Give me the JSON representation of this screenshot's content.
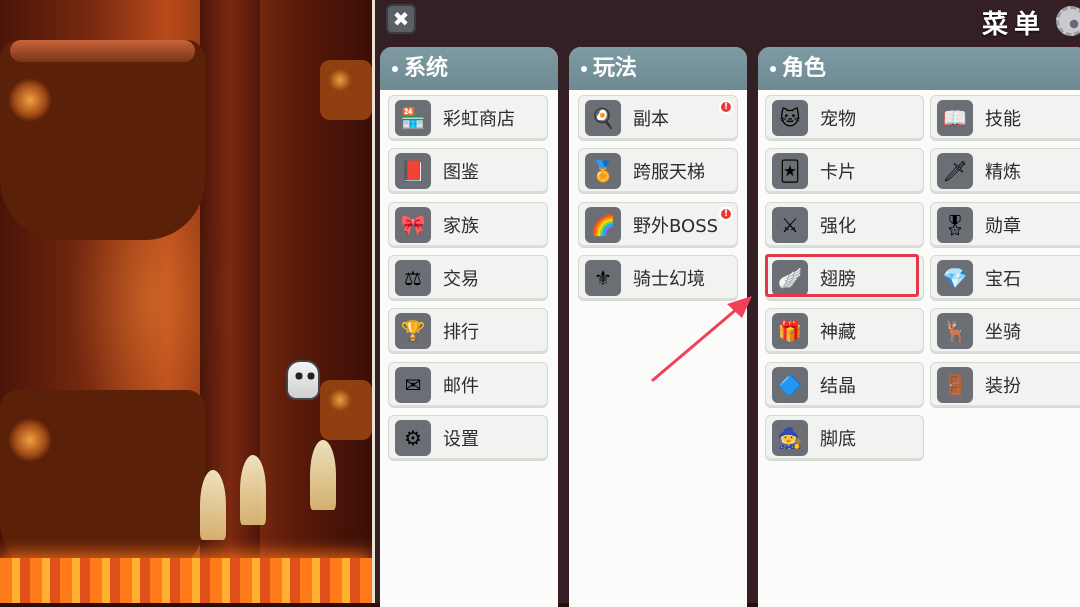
{
  "menu": {
    "title": "菜单",
    "close_symbol": "✖"
  },
  "panels": {
    "system": {
      "header": "系统",
      "items": [
        {
          "label": "彩虹商店",
          "icon": "rainbow-shop-icon",
          "glyph": "🏪"
        },
        {
          "label": "图鉴",
          "icon": "book-icon",
          "glyph": "📕"
        },
        {
          "label": "家族",
          "icon": "family-icon",
          "glyph": "🎀"
        },
        {
          "label": "交易",
          "icon": "trade-icon",
          "glyph": "⚖"
        },
        {
          "label": "排行",
          "icon": "trophy-icon",
          "glyph": "🏆"
        },
        {
          "label": "邮件",
          "icon": "mail-icon",
          "glyph": "✉"
        },
        {
          "label": "设置",
          "icon": "settings-gear-icon",
          "glyph": "⚙"
        }
      ]
    },
    "gameplay": {
      "header": "玩法",
      "items": [
        {
          "label": "副本",
          "icon": "dungeon-icon",
          "glyph": "🍳",
          "badge": "!"
        },
        {
          "label": "跨服天梯",
          "icon": "ladder-icon",
          "glyph": "🏅"
        },
        {
          "label": "野外BOSS",
          "icon": "rainbow-boss-icon",
          "glyph": "🌈",
          "badge": "!"
        },
        {
          "label": "骑士幻境",
          "icon": "knight-wings-icon",
          "glyph": "⚜"
        }
      ]
    },
    "character": {
      "header": "角色",
      "items": [
        {
          "label": "宠物",
          "icon": "pet-icon",
          "glyph": "🐱"
        },
        {
          "label": "技能",
          "icon": "skill-book-icon",
          "glyph": "📖"
        },
        {
          "label": "卡片",
          "icon": "card-icon",
          "glyph": "🃏"
        },
        {
          "label": "精炼",
          "icon": "refine-sword-icon",
          "glyph": "🗡"
        },
        {
          "label": "强化",
          "icon": "enhance-sword-icon",
          "glyph": "⚔"
        },
        {
          "label": "勋章",
          "icon": "medal-icon",
          "glyph": "🎖"
        },
        {
          "label": "翅膀",
          "icon": "wing-icon",
          "glyph": "🪽"
        },
        {
          "label": "宝石",
          "icon": "gem-icon",
          "glyph": "💎"
        },
        {
          "label": "神藏",
          "icon": "treasure-chest-icon",
          "glyph": "🎁"
        },
        {
          "label": "坐骑",
          "icon": "mount-icon",
          "glyph": "🦌"
        },
        {
          "label": "结晶",
          "icon": "crystal-icon",
          "glyph": "🔷"
        },
        {
          "label": "装扮",
          "icon": "outfit-icon",
          "glyph": "🚪"
        },
        {
          "label": "脚底",
          "icon": "footprint-icon",
          "glyph": "🧙"
        }
      ]
    }
  },
  "highlighted_item": "翅膀",
  "colors": {
    "highlight": "#e4374a",
    "header_bg": "#7e9ba3",
    "badge": "#e83a3a"
  }
}
